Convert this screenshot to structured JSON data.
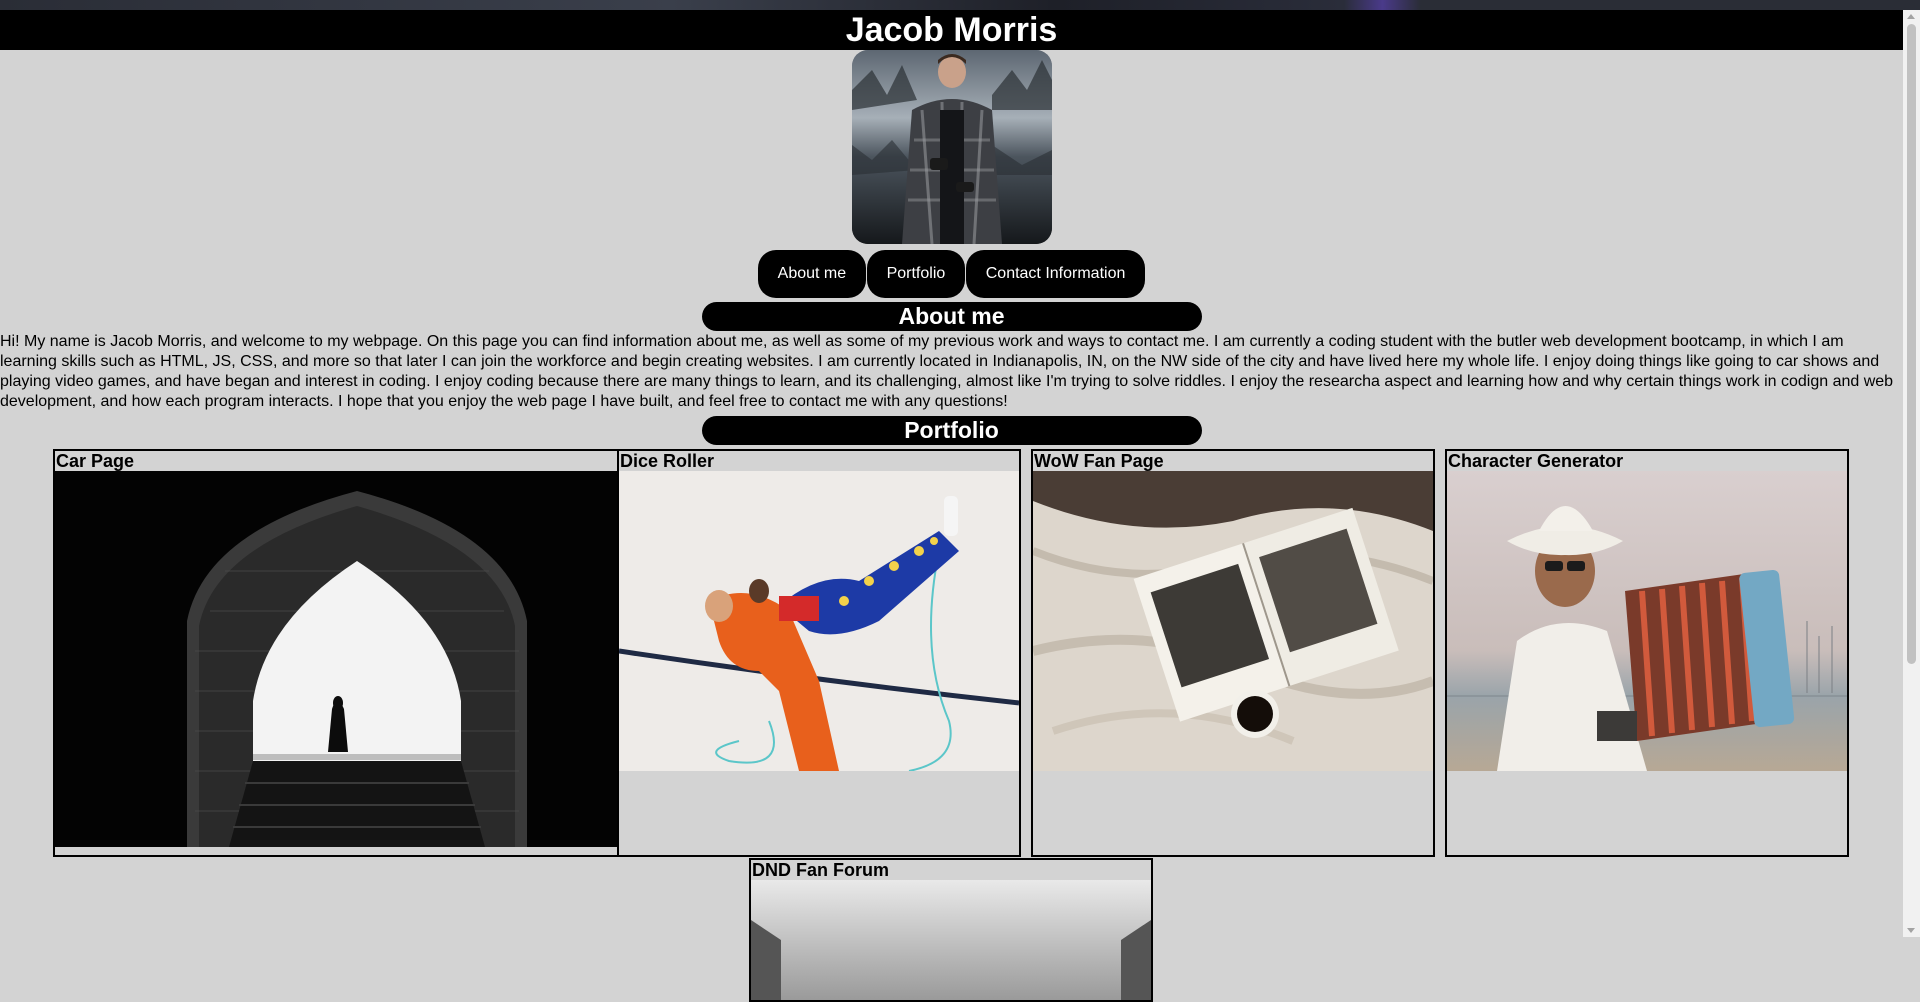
{
  "header": {
    "title": "Jacob Morris"
  },
  "nav": [
    {
      "label": "About me"
    },
    {
      "label": "Portfolio"
    },
    {
      "label": "Contact Information"
    }
  ],
  "about": {
    "heading": "About me",
    "text": "Hi! My name is Jacob Morris, and welcome to my webpage. On this page you can find information about me, as well as some of my previous work and ways to contact me. I am currently a coding student with the butler web development bootcamp, in which I am learning skills such as HTML, JS, CSS, and more so that later I can join the workforce and begin creating websites. I am currently located in Indianapolis, IN, on the NW side of the city and have lived here my whole life. I enjoy doing things like going to car shows and playing video games, and have began and interest in coding. I enjoy coding because there are many things to learn, and its challenging, almost like I'm trying to solve riddles. I enjoy the researcha aspect and learning how and why certain things work in codign and web development, and how each program interacts. I hope that you enjoy the web page I have built, and feel free to contact me with any questions!"
  },
  "portfolio": {
    "heading": "Portfolio",
    "projects": [
      {
        "title": "Car Page",
        "image": "archway-silhouette-photo"
      },
      {
        "title": "Dice Roller",
        "image": "dancers-rope-photo"
      },
      {
        "title": "WoW Fan Page",
        "image": "book-coffee-bed-photo"
      },
      {
        "title": "Character Generator",
        "image": "accordion-player-photo"
      },
      {
        "title": "DND Fan Forum",
        "image": "architecture-photo"
      }
    ]
  },
  "colors": {
    "background": "#d3d3d3",
    "header": "#000000",
    "button": "#000000",
    "button_text": "#ffffff"
  }
}
